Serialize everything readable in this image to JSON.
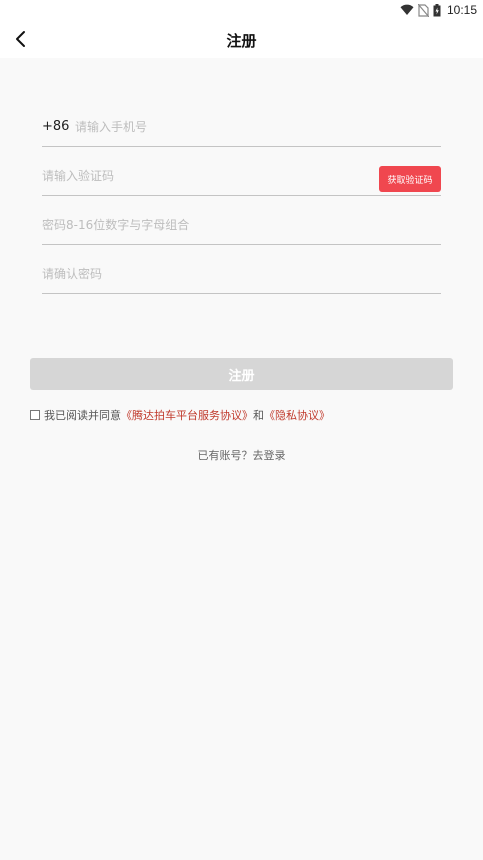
{
  "status_bar": {
    "time": "10:15"
  },
  "header": {
    "title": "注册"
  },
  "form": {
    "country_code": "+86",
    "phone_placeholder": "请输入手机号",
    "code_placeholder": "请输入验证码",
    "get_code_label": "获取验证码",
    "password_placeholder": "密码8-16位数字与字母组合",
    "confirm_placeholder": "请确认密码"
  },
  "actions": {
    "register_label": "注册"
  },
  "agreement": {
    "prefix": "我已阅读并同意",
    "service_link": "《腾达拍车平台服务协议》",
    "and": "和",
    "privacy_link": "《隐私协议》"
  },
  "login": {
    "label": "已有账号？去登录"
  },
  "colors": {
    "accent": "#f0474f",
    "link": "#c0392b",
    "disabled_button": "#d6d6d6"
  }
}
